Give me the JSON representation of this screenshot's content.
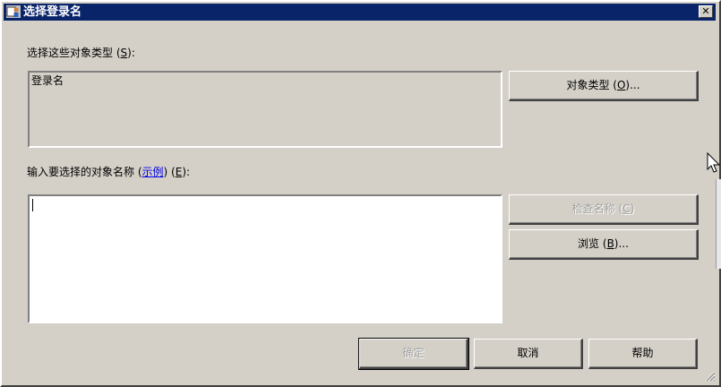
{
  "window": {
    "title": "选择登录名",
    "close_glyph": "✕"
  },
  "object_types": {
    "label": "选择这些对象类型",
    "label_hotkey": "S",
    "label_suffix": ":",
    "value": "登录名",
    "button_label": "对象类型",
    "button_hotkey": "O",
    "button_suffix": "..."
  },
  "names": {
    "label": "输入要选择的对象名称",
    "example_link": "示例",
    "label_hotkey": "E",
    "label_suffix": ":",
    "value": ""
  },
  "buttons": {
    "check_names_label": "检查名称",
    "check_names_hotkey": "C",
    "browse_label": "浏览",
    "browse_hotkey": "B",
    "browse_suffix": "...",
    "ok_label": "确定",
    "cancel_label": "取消",
    "help_label": "帮助"
  },
  "icons": {
    "title": "dialog-users-icon",
    "close": "close-icon",
    "grip": "resize-grip-icon",
    "cursor": "mouse-pointer-icon"
  }
}
